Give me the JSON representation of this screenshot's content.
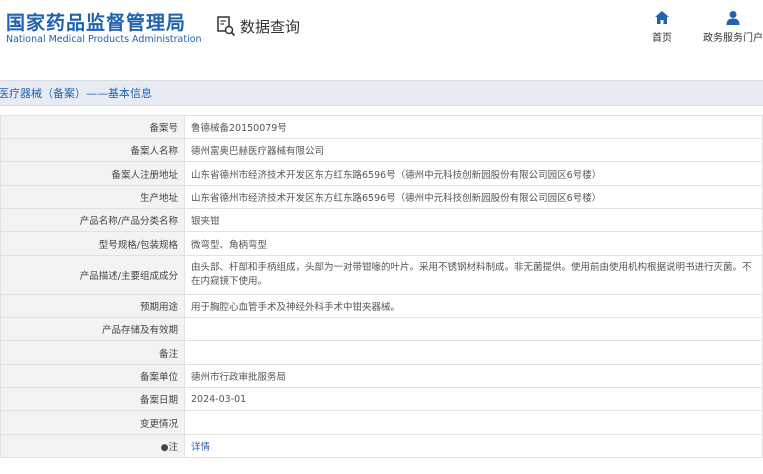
{
  "header": {
    "title_cn": "国家药品监督管理局",
    "title_en": "National Medical Products Administration",
    "query_label": "数据查询",
    "nav": [
      {
        "label": "首页",
        "icon": "home-icon"
      },
      {
        "label": "政务服务门户",
        "icon": "user-icon"
      }
    ]
  },
  "section": {
    "title": "医疗器械（备案）——基本信息"
  },
  "rows": [
    {
      "label": "备案号",
      "value": "鲁德械备20150079号"
    },
    {
      "label": "备案人名称",
      "value": "德州富奥巴赫医疗器械有限公司"
    },
    {
      "label": "备案人注册地址",
      "value": "山东省德州市经济技术开发区东方红东路6596号（德州中元科技创新园股份有限公司园区6号楼）"
    },
    {
      "label": "生产地址",
      "value": "山东省德州市经济技术开发区东方红东路6596号（德州中元科技创新园股份有限公司园区6号楼）"
    },
    {
      "label": "产品名称/产品分类名称",
      "value": "银夹钳"
    },
    {
      "label": "型号规格/包装规格",
      "value": "微弯型、角柄弯型"
    },
    {
      "label": "产品描述/主要组成成分",
      "value": "由头部、杆部和手柄组成，头部为一对带钳喙的叶片。采用不锈钢材料制成。非无菌提供。使用前由使用机构根据说明书进行灭菌。不在内窥镜下使用。"
    },
    {
      "label": "预期用途",
      "value": "用于胸腔心血管手术及神经外科手术中钳夹器械。"
    },
    {
      "label": "产品存储及有效期",
      "value": ""
    },
    {
      "label": "备注",
      "value": ""
    },
    {
      "label": "备案单位",
      "value": "德州市行政审批服务局"
    },
    {
      "label": "备案日期",
      "value": "2024-03-01"
    },
    {
      "label": "变更情况",
      "value": ""
    },
    {
      "label": "注",
      "value": "详情",
      "icon": "pin-icon"
    }
  ],
  "colors": {
    "brand": "#1e62b0",
    "section_bg": "#e8ecf2"
  }
}
